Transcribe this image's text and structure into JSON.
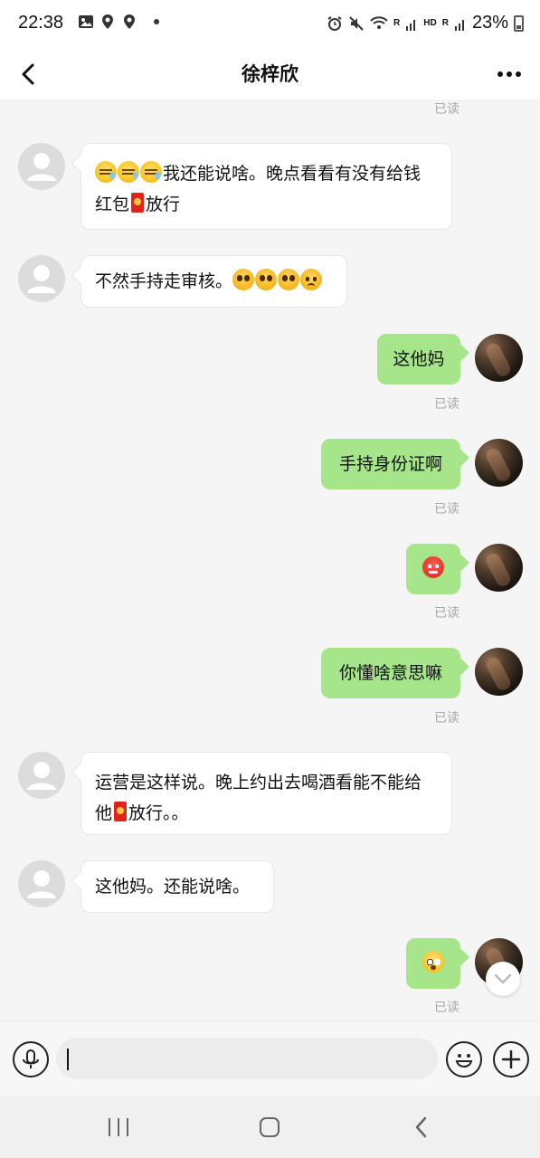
{
  "status_bar": {
    "time": "22:38",
    "network_r1": "R",
    "network_hd": "HD",
    "network_r2": "R",
    "battery": "23%"
  },
  "header": {
    "title": "徐梓欣"
  },
  "read_label": "已读",
  "messages": [
    {
      "side": "left",
      "text_parts": [
        "我还能说啥。晚点看看有没有给",
        "钱红包",
        "放行"
      ],
      "emoji": [
        "sleepy",
        "sleepy",
        "sleepy"
      ]
    },
    {
      "side": "left",
      "text": "不然手持走审核。",
      "emoji": [
        "pleading",
        "pleading",
        "pleading",
        "sad"
      ]
    },
    {
      "side": "right",
      "text": "这他妈",
      "read": "已读"
    },
    {
      "side": "right",
      "text": "手持身份证啊",
      "read": "已读"
    },
    {
      "side": "right",
      "emoji": [
        "angry"
      ],
      "read": "已读"
    },
    {
      "side": "right",
      "text": "你懂啥意思嘛",
      "read": "已读"
    },
    {
      "side": "left",
      "text_parts": [
        "运营是这样说。晚上约出去喝酒看能不能",
        "给他",
        "放行。。"
      ]
    },
    {
      "side": "left",
      "text": "这他妈。还能说啥。"
    },
    {
      "side": "right",
      "emoji": [
        "shocked"
      ],
      "read": "已读"
    }
  ],
  "input": {
    "value": "",
    "placeholder": ""
  },
  "icons": {
    "voice": "microphone-icon",
    "emoji": "smiley-icon",
    "more": "plus-icon",
    "scroll": "chevron-down-icon"
  },
  "colors": {
    "sent_bubble": "#a7e58a",
    "received_bubble": "#ffffff",
    "chat_background": "#f5f5f5"
  }
}
